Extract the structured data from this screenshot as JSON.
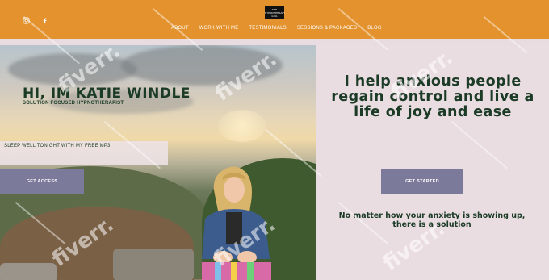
{
  "header": {
    "logo_text": "THE HYPNOTHERAPY GIRL",
    "social_icons": [
      "instagram-icon",
      "facebook-icon"
    ],
    "nav": [
      "ABOUT",
      "WORK WITH ME",
      "TESTIMONIALS",
      "SESSIONS & PACKAGES",
      "BLOG"
    ],
    "background_color": "#e3922d"
  },
  "hero": {
    "title": "HI, IM KATIE WINDLE",
    "subtitle": "SOLUTION FOCUSED HYPNOTHERAPIST",
    "mp3_text": "SLEEP WELL TONIGHT WITH MY FREE MP3",
    "access_button": "GET ACCESS"
  },
  "right_panel": {
    "headline": "I help anxious people regain control and live a life of joy and ease",
    "start_button": "GET STARTED",
    "solution_text": "No matter how your anxiety is showing up, there is a solution"
  },
  "watermark": "fiverr.",
  "colors": {
    "accent": "#e3922d",
    "panel": "#eadde2",
    "button": "#7b7a9a",
    "text": "#1b3b26"
  }
}
